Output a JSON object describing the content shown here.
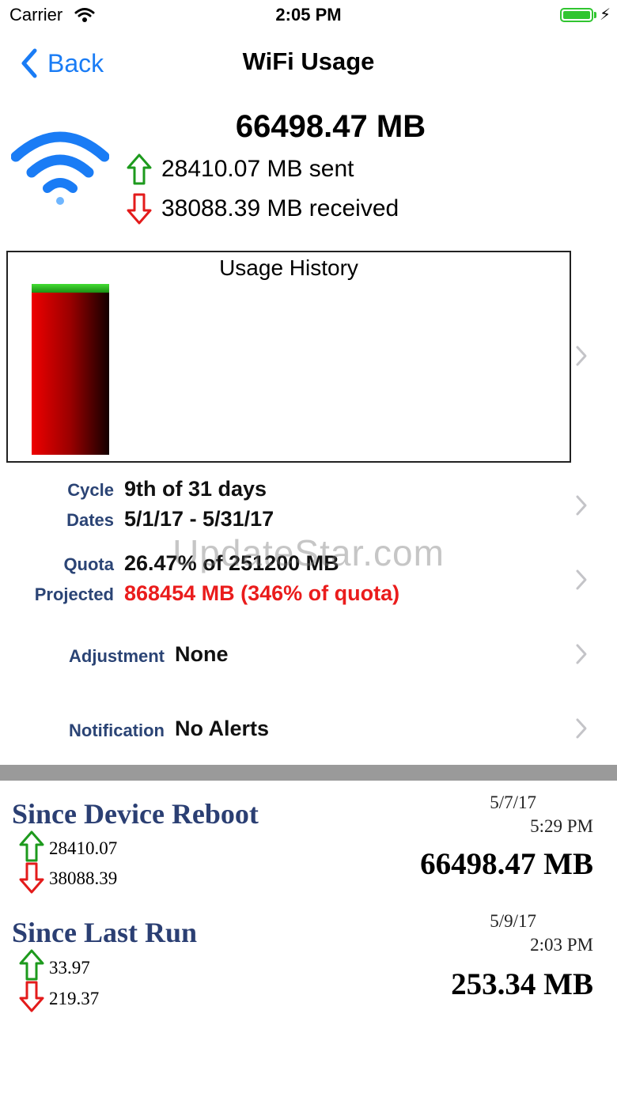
{
  "status_bar": {
    "carrier": "Carrier",
    "time": "2:05 PM"
  },
  "nav": {
    "back_label": "Back",
    "title": "WiFi Usage"
  },
  "summary": {
    "total": "66498.47 MB",
    "sent": "28410.07 MB sent",
    "received": "38088.39 MB received"
  },
  "history": {
    "title": "Usage History"
  },
  "cycle": {
    "label": "Cycle",
    "value": "9th of 31 days"
  },
  "dates": {
    "label": "Dates",
    "value": "5/1/17 - 5/31/17"
  },
  "quota": {
    "label": "Quota",
    "value": "26.47% of 251200 MB"
  },
  "projected": {
    "label": "Projected",
    "value": "868454 MB (346% of quota)"
  },
  "adjustment": {
    "label": "Adjustment",
    "value": "None"
  },
  "notification": {
    "label": "Notification",
    "value": "No Alerts"
  },
  "since_reboot": {
    "title": "Since Device Reboot",
    "date": "5/7/17",
    "time": "5:29 PM",
    "sent": "28410.07",
    "received": "38088.39",
    "total": "66498.47 MB"
  },
  "since_last_run": {
    "title": "Since Last Run",
    "date": "5/9/17",
    "time": "2:03 PM",
    "sent": "33.97",
    "received": "219.37",
    "total": "253.34 MB"
  },
  "watermark": "UpdateStar.com",
  "colors": {
    "accent": "#1a7cf5",
    "label": "#2b4475",
    "alert": "#ea1c1c",
    "up_arrow": "#1d9a1d",
    "down_arrow": "#e31b1b"
  },
  "icons": [
    "wifi-status-icon",
    "battery-icon",
    "chevron-left-icon",
    "wifi-icon",
    "arrow-up-icon",
    "arrow-down-icon",
    "chevron-right-icon"
  ]
}
